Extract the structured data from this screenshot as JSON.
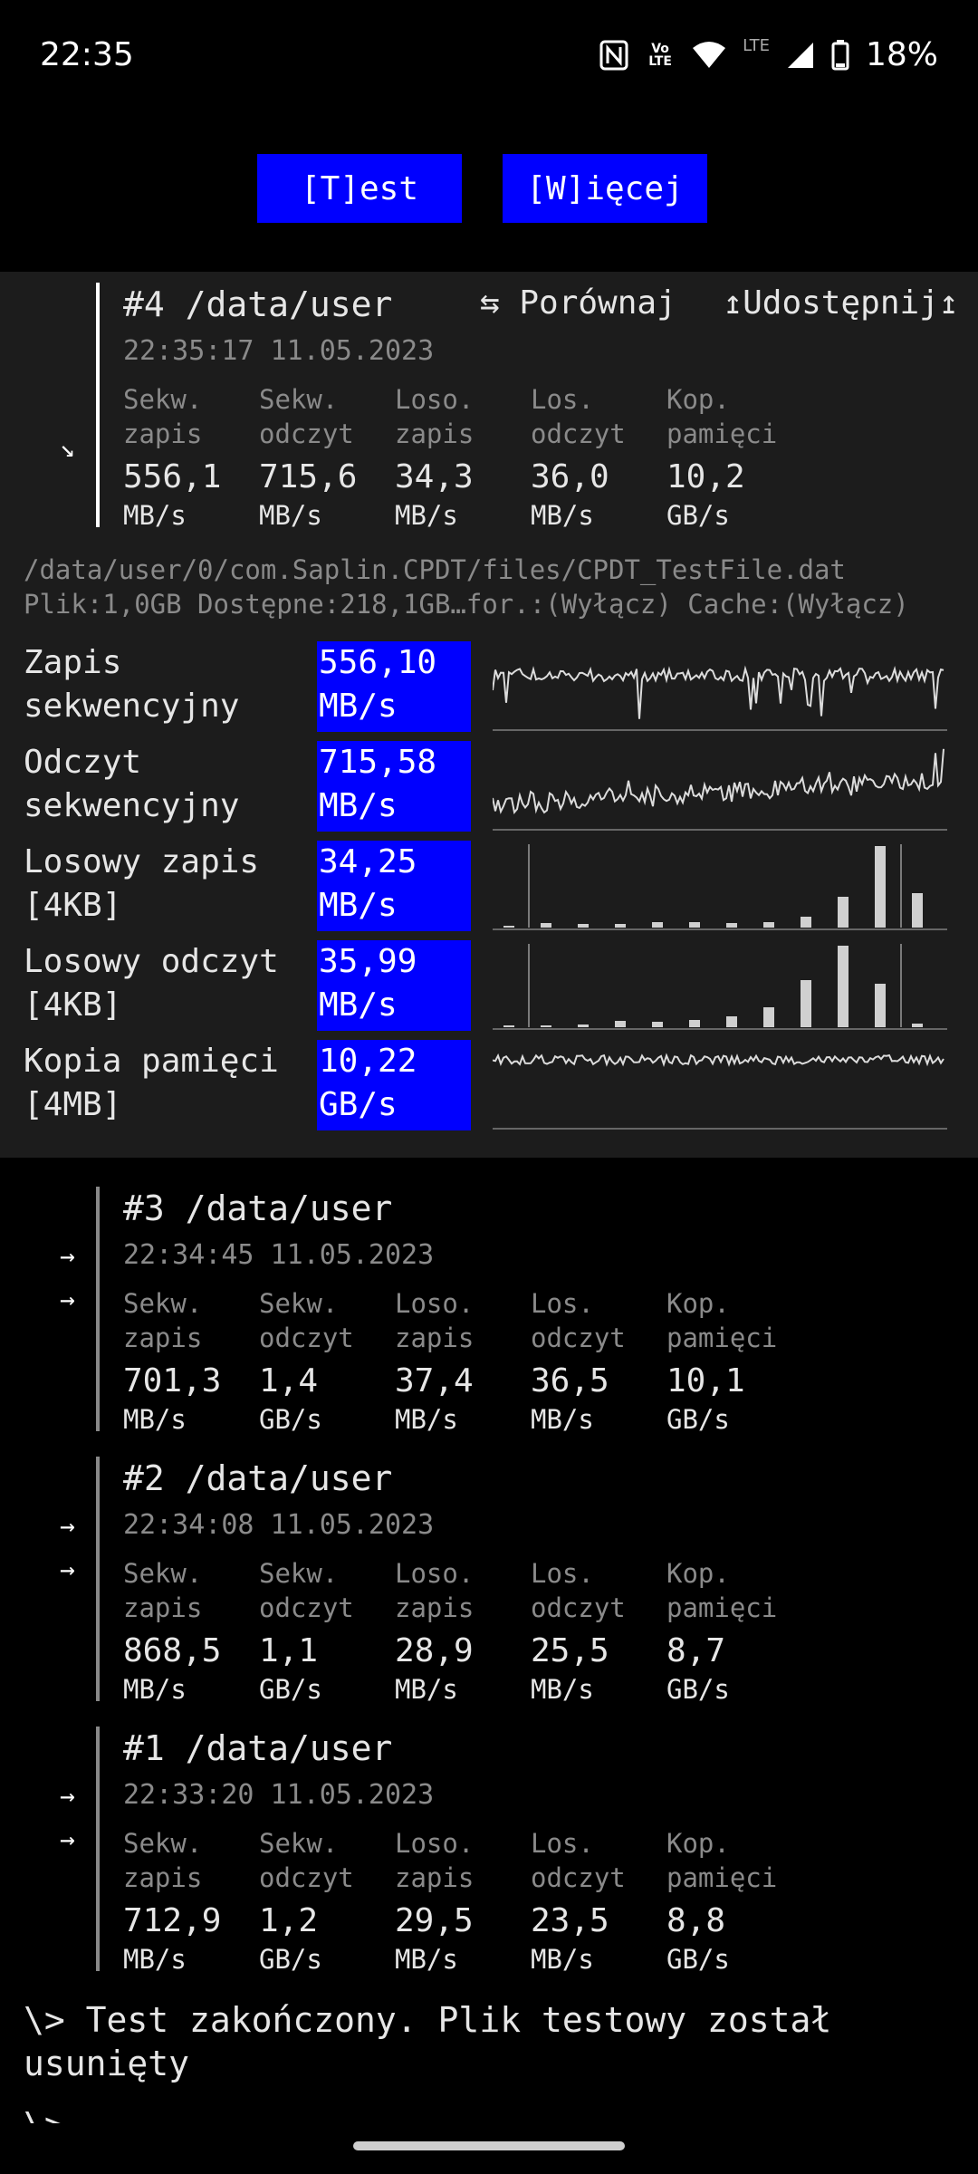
{
  "status": {
    "time": "22:35",
    "battery": "18%",
    "network_label": "LTE",
    "volte_label": "Vo LTE"
  },
  "buttons": {
    "test": "[T]est",
    "more": "[W]ięcej"
  },
  "metric_labels": [
    {
      "l1": "Sekw.",
      "l2": "zapis"
    },
    {
      "l1": "Sekw.",
      "l2": "odczyt"
    },
    {
      "l1": "Loso.",
      "l2": "zapis"
    },
    {
      "l1": "Los.",
      "l2": "odczyt"
    },
    {
      "l1": "Kop.",
      "l2": "pamięci"
    }
  ],
  "latest": {
    "title": "#4 /data/user",
    "date": "22:35:17 11.05.2023",
    "compare": "⇆ Porównaj",
    "share": "↥Udostępnij↥",
    "arrow": "↘",
    "values": [
      {
        "value": "556,1",
        "unit": "MB/s"
      },
      {
        "value": "715,6",
        "unit": "MB/s"
      },
      {
        "value": "34,3",
        "unit": "MB/s"
      },
      {
        "value": "36,0",
        "unit": "MB/s"
      },
      {
        "value": "10,2",
        "unit": "GB/s"
      }
    ],
    "path": "/data/user/0/com.Saplin.CPDT/files/CPDT_TestFile.dat",
    "file_info": "Plik:1,0GB Dostępne:218,1GB…for.:(Wyłącz) Cache:(Wyłącz)"
  },
  "benchmarks": [
    {
      "label1": "Zapis",
      "label2": "sekwencyjny",
      "value": "556,10",
      "unit": "MB/s",
      "graph": "line"
    },
    {
      "label1": "Odczyt",
      "label2": "sekwencyjny",
      "value": "715,58",
      "unit": "MB/s",
      "graph": "line"
    },
    {
      "label1": "Losowy zapis",
      "label2": "[4KB]",
      "value": "34,25",
      "unit": "MB/s",
      "graph": "bars"
    },
    {
      "label1": "Losowy odczyt",
      "label2": "[4KB]",
      "value": "35,99",
      "unit": "MB/s",
      "graph": "bars"
    },
    {
      "label1": "Kopia pamięci",
      "label2": "[4MB]",
      "value": "10,22",
      "unit": "GB/s",
      "graph": "line"
    }
  ],
  "history": [
    {
      "title": "#3 /data/user",
      "date": "22:34:45 11.05.2023",
      "values": [
        {
          "value": "701,3",
          "unit": "MB/s"
        },
        {
          "value": "1,4",
          "unit": "GB/s"
        },
        {
          "value": "37,4",
          "unit": "MB/s"
        },
        {
          "value": "36,5",
          "unit": "MB/s"
        },
        {
          "value": "10,1",
          "unit": "GB/s"
        }
      ]
    },
    {
      "title": "#2 /data/user",
      "date": "22:34:08 11.05.2023",
      "values": [
        {
          "value": "868,5",
          "unit": "MB/s"
        },
        {
          "value": "1,1",
          "unit": "GB/s"
        },
        {
          "value": "28,9",
          "unit": "MB/s"
        },
        {
          "value": "25,5",
          "unit": "MB/s"
        },
        {
          "value": "8,7",
          "unit": "GB/s"
        }
      ]
    },
    {
      "title": "#1 /data/user",
      "date": "22:33:20 11.05.2023",
      "values": [
        {
          "value": "712,9",
          "unit": "MB/s"
        },
        {
          "value": "1,2",
          "unit": "GB/s"
        },
        {
          "value": "29,5",
          "unit": "MB/s"
        },
        {
          "value": "23,5",
          "unit": "MB/s"
        },
        {
          "value": "8,8",
          "unit": "GB/s"
        }
      ]
    }
  ],
  "history_arrow": "→",
  "final_message": "\\> Test zakończony. Plik testowy został usunięty",
  "prompt": "\\>",
  "colors": {
    "accent": "#0000ff",
    "panel": "#1c1c1c",
    "background": "#000000",
    "muted": "#8a8a8a"
  }
}
